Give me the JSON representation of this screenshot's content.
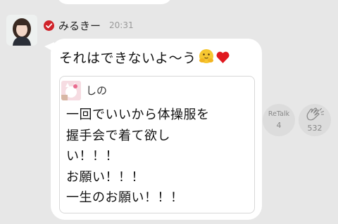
{
  "message": {
    "sender_name": "みるきー",
    "time": "20:31",
    "text": "それはできないよ～う",
    "emojis": [
      "hugging-face-emoji",
      "red-heart-emoji"
    ]
  },
  "quote": {
    "name": "しの",
    "lines": [
      "一回でいいから体操服を",
      "握手会で着て欲し",
      "い！！！",
      "お願い！！！",
      "一生のお願い！！！"
    ]
  },
  "actions": {
    "retalk_label": "ReTalk",
    "retalk_count": "4",
    "clap_count": "532"
  },
  "colors": {
    "background": "#e7e7e7",
    "bubble": "#ffffff",
    "verified": "#d0232a",
    "heart": "#e0191f",
    "emoji": "#f6c731",
    "action_button": "#dcdcdc"
  }
}
